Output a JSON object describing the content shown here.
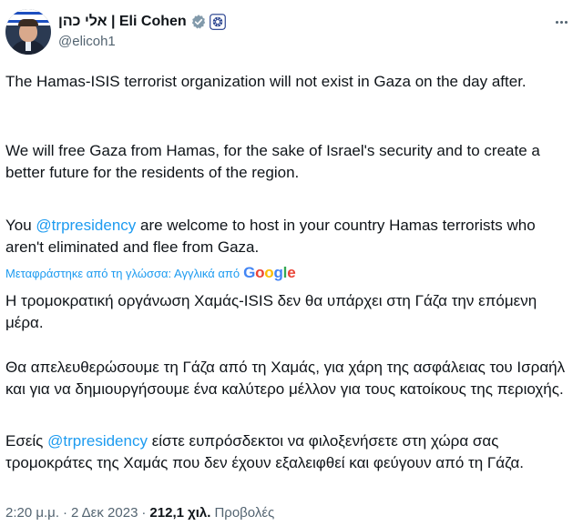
{
  "author": {
    "display_name": "אלי כהן | Eli Cohen",
    "handle": "@elicoh1"
  },
  "tweet": {
    "paragraphs": [
      {
        "text_before": "The Hamas-ISIS terrorist organization will not exist in Gaza on the day after."
      },
      {
        "text_before": "We will free Gaza from Hamas, for the sake of Israel's security and to create a better future for the residents of the region."
      },
      {
        "text_before": "You ",
        "mention": "@trpresidency",
        "text_after": " are welcome to host in your country Hamas terrorists who aren't eliminated and flee from Gaza."
      }
    ]
  },
  "translation": {
    "label": "Μεταφράστηκε από τη γλώσσα: Αγγλικά από",
    "provider": "Google",
    "paragraphs": [
      {
        "text_before": "Η τρομοκρατική οργάνωση Χαμάς-ISIS δεν θα υπάρχει στη Γάζα την επόμενη μέρα."
      },
      {
        "text_before": "Θα απελευθερώσουμε τη Γάζα από τη Χαμάς, για χάρη της ασφάλειας του Ισραήλ και για να δημιουργήσουμε ένα καλύτερο μέλλον για τους κατοίκους της περιοχής."
      },
      {
        "text_before": "Εσείς ",
        "mention": "@trpresidency",
        "text_after": " είστε ευπρόσδεκτοι να φιλοξενήσετε στη χώρα σας τρομοκράτες της Χαμάς που δεν έχουν εξαλειφθεί και φεύγουν από τη Γάζα."
      }
    ]
  },
  "meta": {
    "time": "2:20 μ.μ.",
    "date": "2 Δεκ 2023",
    "separator": "·",
    "views_count": "212,1 χιλ.",
    "views_label": "Προβολές"
  },
  "icons": {
    "verified": "verified-badge-gray",
    "affiliation": "government-affiliation-badge",
    "more": "more-options-dots"
  },
  "colors": {
    "text": "#0f1419",
    "secondary": "#536471",
    "accent": "#1d9bf0",
    "verified_gray": "#829aab"
  }
}
